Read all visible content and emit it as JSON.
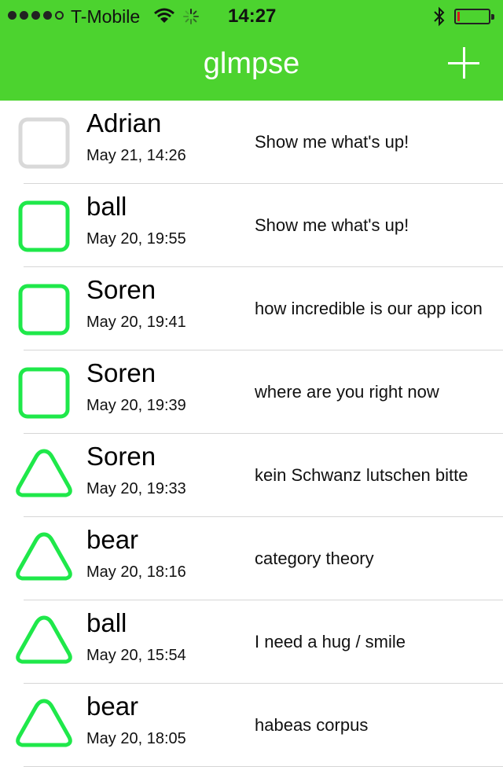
{
  "status_bar": {
    "carrier": "T-Mobile",
    "time": "14:27",
    "signal_bars": 4,
    "signal_total": 5,
    "battery_level_percent": 8
  },
  "nav": {
    "title": "glmpse",
    "add_icon": "plus-icon"
  },
  "colors": {
    "brand": "#4cd32f",
    "shape_active": "#1fe84a",
    "shape_inactive": "#d9d9d9",
    "battery_low": "#d81c1c"
  },
  "messages": [
    {
      "name": "Adrian",
      "date": "May 21, 14:26",
      "text": "Show me what's up!",
      "shape": "square",
      "state": "inactive"
    },
    {
      "name": "ball",
      "date": "May 20, 19:55",
      "text": "Show me what's up!",
      "shape": "square",
      "state": "active"
    },
    {
      "name": "Soren",
      "date": "May 20, 19:41",
      "text": "how incredible is our app icon",
      "shape": "square",
      "state": "active"
    },
    {
      "name": "Soren",
      "date": "May 20, 19:39",
      "text": "where are you right now",
      "shape": "square",
      "state": "active"
    },
    {
      "name": "Soren",
      "date": "May 20, 19:33",
      "text": "kein Schwanz lutschen bitte",
      "shape": "triangle",
      "state": "active"
    },
    {
      "name": "bear",
      "date": "May 20, 18:16",
      "text": "category theory",
      "shape": "triangle",
      "state": "active"
    },
    {
      "name": "ball",
      "date": "May 20, 15:54",
      "text": "I need a hug / smile",
      "shape": "triangle",
      "state": "active"
    },
    {
      "name": "bear",
      "date": "May 20, 18:05",
      "text": "habeas corpus",
      "shape": "triangle",
      "state": "active"
    }
  ]
}
